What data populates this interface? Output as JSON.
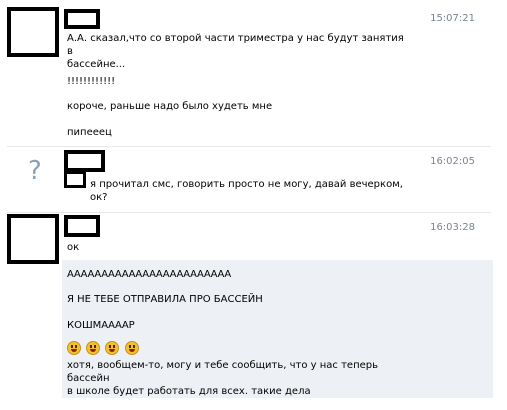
{
  "messages": [
    {
      "time": "15:07:21",
      "lines": [
        "А.А. сказал,что со второй части триместра у нас будут занятия в\nбассейне...",
        "!!!!!!!!!!!!",
        "короче, раньше надо было худеть мне",
        "пипееец"
      ]
    },
    {
      "time": "16:02:05",
      "avatar_glyph": "?",
      "lines": [
        "я прочитал смс, говорить просто не могу, давай вечерком,\nок?"
      ]
    },
    {
      "time": "16:03:28",
      "lines": [
        "ок",
        "АААААААААААААААААААААААА",
        "Я НЕ ТЕБЕ ОТПРАВИЛА ПРО БАССЕЙН",
        "КОШМААААР",
        "хотя, вообщем-то, могу и тебе сообщить, что у нас теперь бассейн\nв школе будет работать для всех. такие дела"
      ],
      "emoji_count": 4
    }
  ],
  "colors": {
    "timestamp": "#7a8593",
    "highlight": "#edf1f5",
    "divider": "#e4e8ec"
  }
}
